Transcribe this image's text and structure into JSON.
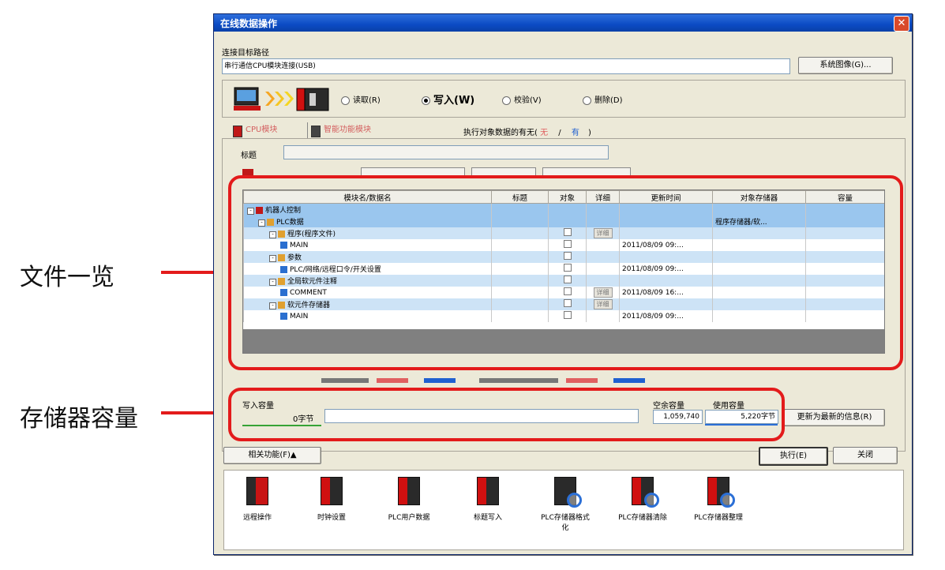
{
  "annotations": {
    "file_list": "文件一览",
    "memory_capacity": "存储器容量"
  },
  "colors": {
    "highlight": "#e31b1b",
    "titlebar": "#0b4bc4",
    "row_blue": "#9ac6ee",
    "row_light": "#cde3f6"
  },
  "dialog": {
    "title": "在线数据操作",
    "connection": {
      "label": "连接目标路径",
      "value": "串行通信CPU模块连接(USB)",
      "button": "系统图像(G)..."
    },
    "operations": [
      {
        "label": "读取(R)",
        "selected": false
      },
      {
        "label": "写入(W)",
        "selected": true
      },
      {
        "label": "校验(V)",
        "selected": false
      },
      {
        "label": "删除(D)",
        "selected": false
      }
    ],
    "tabs": [
      {
        "label": "CPU模块"
      },
      {
        "label": "智能功能模块"
      }
    ],
    "target_existence": {
      "prefix": "执行对象数据的有无(",
      "no": "无",
      "sep": "/",
      "yes": "有",
      "suffix": ")"
    },
    "title_label": "标题",
    "table": {
      "columns": [
        "模块名/数据名",
        "标题",
        "对象",
        "详细",
        "更新时间",
        "对象存储器",
        "容量"
      ],
      "rows": [
        {
          "name": "机器人控制",
          "level": 0,
          "style": "blue",
          "checkbox": false,
          "detail": "",
          "updated": "",
          "memory": ""
        },
        {
          "name": "PLC数据",
          "level": 1,
          "style": "blue",
          "checkbox": false,
          "detail": "",
          "updated": "",
          "memory": "程序存储器/软..."
        },
        {
          "name": "程序(程序文件)",
          "level": 2,
          "style": "light",
          "checkbox": true,
          "detail": "详细",
          "updated": "",
          "memory": ""
        },
        {
          "name": "MAIN",
          "level": 3,
          "style": "white",
          "checkbox": true,
          "detail": "",
          "updated": "2011/08/09 09:...",
          "memory": ""
        },
        {
          "name": "参数",
          "level": 2,
          "style": "light",
          "checkbox": true,
          "detail": "",
          "updated": "",
          "memory": ""
        },
        {
          "name": "PLC/网络/远程口令/开关设置",
          "level": 3,
          "style": "white",
          "checkbox": true,
          "detail": "",
          "updated": "2011/08/09 09:...",
          "memory": ""
        },
        {
          "name": "全局软元件注释",
          "level": 2,
          "style": "light",
          "checkbox": true,
          "detail": "",
          "updated": "",
          "memory": ""
        },
        {
          "name": "COMMENT",
          "level": 3,
          "style": "white",
          "checkbox": true,
          "detail": "详细",
          "updated": "2011/08/09 16:...",
          "memory": ""
        },
        {
          "name": "软元件存储器",
          "level": 2,
          "style": "light",
          "checkbox": true,
          "detail": "详细",
          "updated": "",
          "memory": ""
        },
        {
          "name": "MAIN",
          "level": 3,
          "style": "white",
          "checkbox": true,
          "detail": "",
          "updated": "2011/08/09 09:...",
          "memory": ""
        }
      ]
    },
    "capacity": {
      "write_label": "写入容量",
      "write_value": "0字节",
      "free_label": "空余容量",
      "free_value": "1,059,740",
      "used_label": "使用容量",
      "used_value": "5,220字节",
      "refresh_button": "更新为最新的信息(R)"
    },
    "related_button": "相关功能(F)▲",
    "execute_button": "执行(E)",
    "close_button": "关闭",
    "tools": [
      {
        "label": "远程操作"
      },
      {
        "label": "时钟设置"
      },
      {
        "label": "PLC用户数据"
      },
      {
        "label": "标题写入"
      },
      {
        "label": "PLC存储器格式化"
      },
      {
        "label": "PLC存储器清除"
      },
      {
        "label": "PLC存储器整理"
      }
    ]
  }
}
